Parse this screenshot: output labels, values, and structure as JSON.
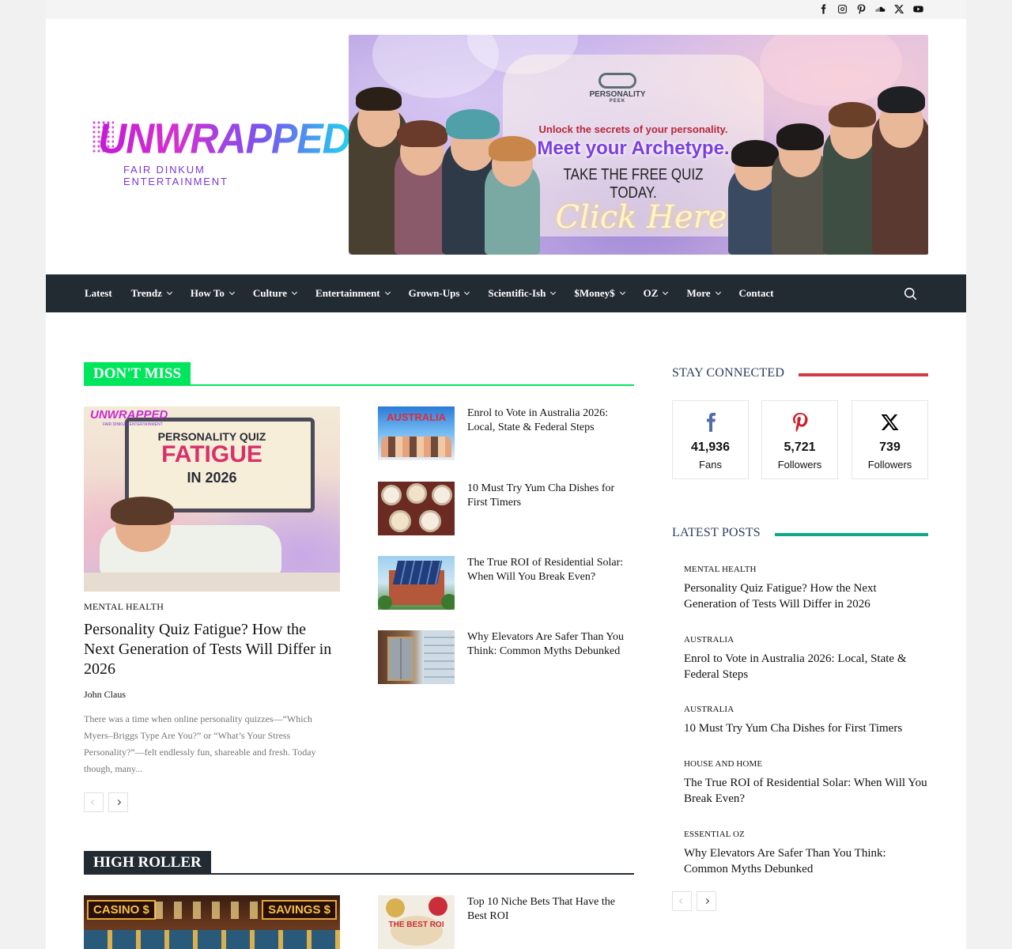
{
  "colors": {
    "nav_bg": "#222a32",
    "dont_miss": "#00e65c",
    "high_roller": "#222a32",
    "stay_connected_line": "#d63943",
    "latest_posts_line": "#0fa88a",
    "facebook": "#516eab",
    "pinterest": "#ca212a",
    "x": "#000000"
  },
  "topbar": {
    "social_icons": [
      "facebook-icon",
      "instagram-icon",
      "pinterest-icon",
      "soundcloud-icon",
      "x-icon",
      "youtube-icon"
    ]
  },
  "logo": {
    "main": "UNWRAPPED",
    "sub": "FAIR DINKUM ENTERTAINMENT"
  },
  "banner": {
    "brand": "PERSONALITY",
    "brand_sub": "PEEK",
    "line1": "Unlock the secrets of your personality.",
    "line2": "Meet your Archetype.",
    "line3": "TAKE THE FREE QUIZ TODAY.",
    "cta": "Click Here"
  },
  "nav": {
    "items": [
      {
        "label": "Latest",
        "dropdown": false
      },
      {
        "label": "Trendz",
        "dropdown": true
      },
      {
        "label": "How To",
        "dropdown": true
      },
      {
        "label": "Culture",
        "dropdown": true
      },
      {
        "label": "Entertainment",
        "dropdown": true
      },
      {
        "label": "Grown-Ups",
        "dropdown": true
      },
      {
        "label": "Scientific-Ish",
        "dropdown": true
      },
      {
        "label": "$Money$",
        "dropdown": true
      },
      {
        "label": "OZ",
        "dropdown": true
      },
      {
        "label": "More",
        "dropdown": true
      },
      {
        "label": "Contact",
        "dropdown": false
      }
    ],
    "search_icon": "search-icon"
  },
  "dont_miss": {
    "heading": "DON'T MISS",
    "featured": {
      "image": {
        "logo": "UNWRAPPED",
        "logo_sub": "FAIR DINKUM ENTERTAINMENT",
        "line1": "PERSONALITY QUIZ",
        "line2": "FATIGUE",
        "line3": "IN 2026"
      },
      "category": "MENTAL HEALTH",
      "title": "Personality Quiz Fatigue? How the Next Generation of Tests Will Differ in 2026",
      "author": "John Claus",
      "excerpt": "There was a time when online personality quizzes—“Which Myers–Briggs Type Are You?” or “What’s Your Stress Personality?”—felt endlessly fun, shareable and fresh. Today though, many..."
    },
    "list": [
      {
        "title": "Enrol to Vote in Australia 2026: Local, State & Federal Steps",
        "thumb_text": "AUSTRALIA"
      },
      {
        "title": "10 Must Try Yum Cha Dishes for First Timers"
      },
      {
        "title": "The True ROI of Residential Solar: When Will You Break Even?"
      },
      {
        "title": "Why Elevators Are Safer Than You Think: Common Myths Debunked"
      }
    ]
  },
  "high_roller": {
    "heading": "HIGH ROLLER",
    "featured_image": {
      "sign_left": "CASINO $",
      "sign_right": "SAVINGS $"
    },
    "list": [
      {
        "title": "Top 10 Niche Bets That Have the Best ROI",
        "thumb_text": "THE BEST ROI"
      }
    ]
  },
  "stay_connected": {
    "heading": "STAY CONNECTED",
    "boxes": [
      {
        "icon": "facebook-icon",
        "count": "41,936",
        "label": "Fans"
      },
      {
        "icon": "pinterest-icon",
        "count": "5,721",
        "label": "Followers"
      },
      {
        "icon": "x-icon",
        "count": "739",
        "label": "Followers"
      }
    ]
  },
  "latest_posts": {
    "heading": "LATEST POSTS",
    "items": [
      {
        "category": "MENTAL HEALTH",
        "title": "Personality Quiz Fatigue? How the Next Generation of Tests Will Differ in 2026"
      },
      {
        "category": "AUSTRALIA",
        "title": "Enrol to Vote in Australia 2026: Local, State & Federal Steps"
      },
      {
        "category": "AUSTRALIA",
        "title": "10 Must Try Yum Cha Dishes for First Timers"
      },
      {
        "category": "HOUSE AND HOME",
        "title": "The True ROI of Residential Solar: When Will You Break Even?"
      },
      {
        "category": "ESSENTIAL OZ",
        "title": "Why Elevators Are Safer Than You Think: Common Myths Debunked"
      }
    ]
  }
}
